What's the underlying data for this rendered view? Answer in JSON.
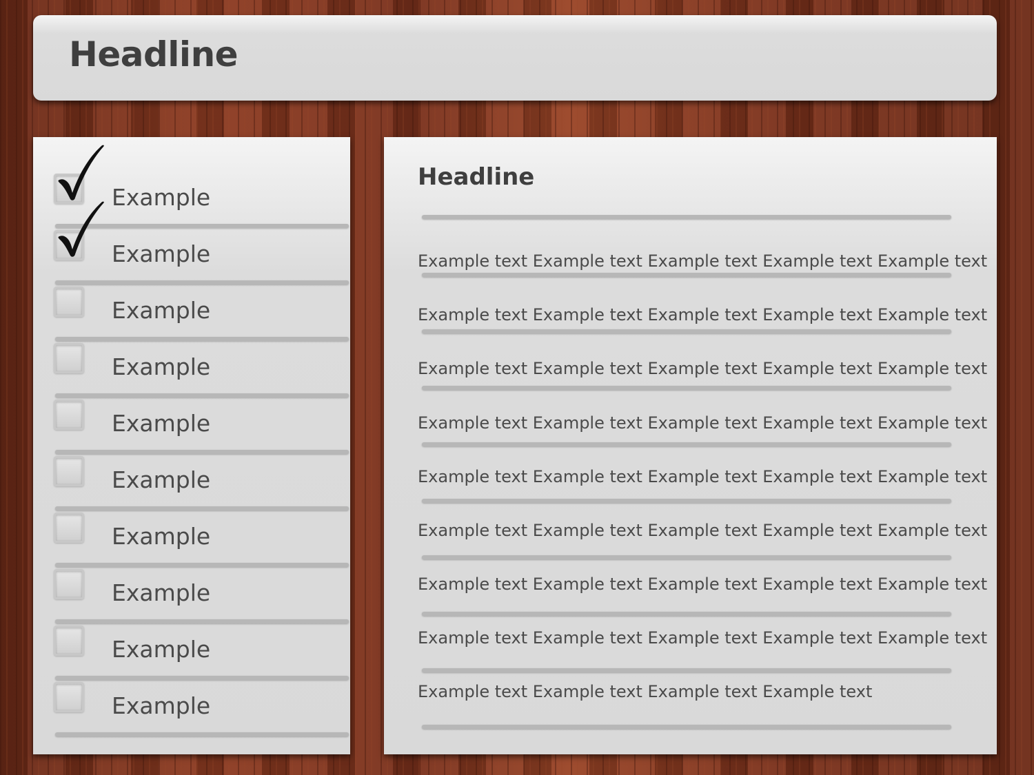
{
  "header": {
    "title": "Headline"
  },
  "checklist": {
    "items": [
      {
        "label": "Example",
        "checked": true
      },
      {
        "label": "Example",
        "checked": true
      },
      {
        "label": "Example",
        "checked": false
      },
      {
        "label": "Example",
        "checked": false
      },
      {
        "label": "Example",
        "checked": false
      },
      {
        "label": "Example",
        "checked": false
      },
      {
        "label": "Example",
        "checked": false
      },
      {
        "label": "Example",
        "checked": false
      },
      {
        "label": "Example",
        "checked": false
      },
      {
        "label": "Example",
        "checked": false
      }
    ]
  },
  "content": {
    "title": "Headline",
    "lines": [
      "Example text Example text Example text Example text Example text",
      "Example text Example text Example text Example text Example text",
      "Example text Example text Example text Example text Example text",
      "Example text Example text Example text Example text Example text",
      "Example text Example text Example text Example text Example text",
      "Example text Example text Example text Example text Example text",
      "Example text Example text Example text Example text Example text",
      "Example text Example text Example text Example text Example text",
      "Example text Example text Example text Example text"
    ]
  },
  "colors": {
    "panel": "#d9d9d9",
    "text": "#4a4a4a",
    "heading": "#3f3f3f",
    "rule": "#b7b7b7",
    "wood": "#8a3a22",
    "checkmark": "#111111"
  },
  "icons": {
    "checkmark": "checkmark-icon"
  }
}
